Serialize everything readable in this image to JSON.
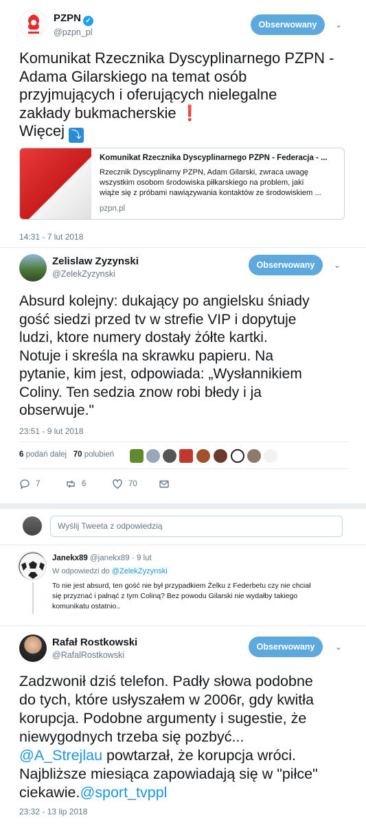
{
  "tweet1": {
    "name": "PZPN",
    "handle": "@pzpn_pl",
    "follow_label": "Obserwowany",
    "lines": [
      "Komunikat Rzecznika Dyscyplinarnego PZPN -",
      "Adama Gilarskiego na temat osób",
      "przyjmujących i oferujących nielegalne",
      "zakłady bukmacherskie"
    ],
    "excl": "❗",
    "more": "Więcej",
    "more_emoji": "⤵",
    "card": {
      "title": "Komunikat Rzecznika Dyscyplinarnego PZPN - Federacja - ...",
      "desc": [
        "Rzecznik Dyscyplinarny PZPN, Adam Gilarski, zwraca uwagę",
        "wszystkim osobom środowiska piłkarskiego na problem, jaki",
        "wiąże się z próbami nawiązywania kontaktów ze środowiskiem ..."
      ],
      "domain": "pzpn.pl"
    },
    "time": "14:31 - 7 lut 2018"
  },
  "tweet2": {
    "name": "Zelislaw Zyzynski",
    "handle": "@ZelekZyzynski",
    "follow_label": "Obserwowany",
    "lines": [
      "Absurd kolejny: dukający po angielsku śniady",
      "gość siedzi przed tv w strefie VIP i dopytuje",
      "ludzi, ktore numery dostały żółte kartki.",
      "Notuje i skreśla na skrawku papieru. Na",
      "pytanie, kim jest, odpowiada: „Wysłannikiem",
      "Coliny. Ten sedzia znow robi błedy i ja",
      "obserwuje.\""
    ],
    "time": "23:51 - 9 lut 2018",
    "retweets_count": "6",
    "retweets_label": "podań dalej",
    "likes_count": "70",
    "likes_label": "polubień",
    "actions": {
      "replies": "7",
      "retweets": "6",
      "likes": "70"
    },
    "reply_placeholder": "Wyślij Tweeta z odpowiedzią"
  },
  "reply": {
    "name": "Janekx89",
    "handle": "@janekx89",
    "age": "9 lut",
    "reply_to_label": "W odpowiedzi do",
    "reply_to_handle": "@ZelekZyzynski",
    "lines": [
      "To nie jest absurd, ten gość nie był przypadkiem Żelku z Federbetu czy nie chciał",
      "się przyznać i palnąć z tym Coliną? Bez powodu Gilarski nie wydałby takiego",
      "komunikatu ostatnio.."
    ]
  },
  "tweet3": {
    "name": "Rafał Rostkowski",
    "handle": "@RafalRostkowski",
    "follow_label": "Obserwowany",
    "lines": [
      "Zadzwonił dziś telefon. Padły słowa podobne",
      "do tych, które usłyszałem w 2006r, gdy kwitła",
      "korupcja. Podobne argumenty i sugestie, że",
      "niewygodnych trzeba się pozbyć..."
    ],
    "mention1": "@A_Strejlau",
    "line5_rest": " powtarzał, że korupcja wróci.",
    "line6": "Najbliższe miesiąca zapowiadają się w \"piłce\"",
    "line7_start": "ciekawie.",
    "mention2": "@sport_tvppl",
    "time": "23:32 - 13 lip 2018"
  },
  "colors": {
    "accent": "#1da1f2",
    "follow": "#5da9dd",
    "muted": "#657786"
  }
}
